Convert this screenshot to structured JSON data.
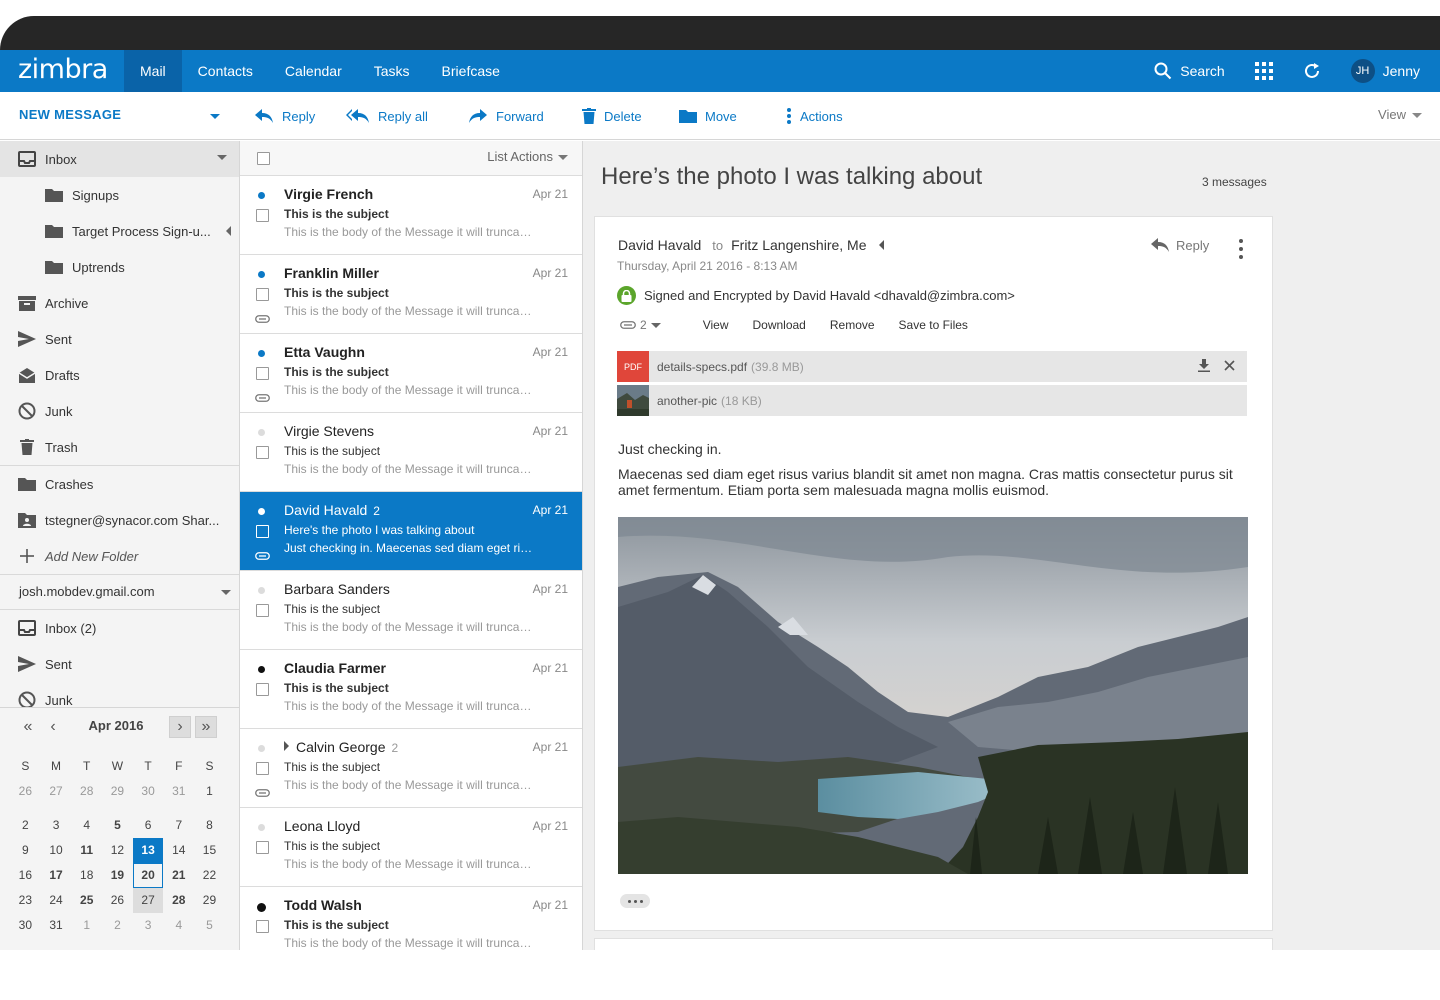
{
  "header": {
    "logo": "zimbra",
    "tabs": [
      {
        "label": "Mail"
      },
      {
        "label": "Contacts"
      },
      {
        "label": "Calendar"
      },
      {
        "label": "Tasks"
      },
      {
        "label": "Briefcase"
      }
    ],
    "search_label": "Search",
    "user": {
      "initials": "JH",
      "name": "Jenny"
    },
    "brand_color": "#0b79c6"
  },
  "toolbar": {
    "new_message": "NEW MESSAGE",
    "reply": "Reply",
    "reply_all": "Reply all",
    "forward": "Forward",
    "delete": "Delete",
    "move": "Move",
    "actions": "Actions",
    "view": "View"
  },
  "sidebar": {
    "folders": [
      {
        "label": "Inbox",
        "icon": "inbox-icon"
      },
      {
        "label": "Signups",
        "icon": "folder-icon"
      },
      {
        "label": "Target Process Sign-u...",
        "icon": "folder-icon"
      },
      {
        "label": "Uptrends",
        "icon": "folder-icon"
      },
      {
        "label": "Archive",
        "icon": "archive-icon"
      },
      {
        "label": "Sent",
        "icon": "send-icon"
      },
      {
        "label": "Drafts",
        "icon": "drafts-icon"
      },
      {
        "label": "Junk",
        "icon": "block-icon"
      },
      {
        "label": "Trash",
        "icon": "trash-icon"
      },
      {
        "label": "Crashes",
        "icon": "folder-icon"
      },
      {
        "label": "tstegner@synacor.com Shar...",
        "icon": "shared-folder-icon"
      },
      {
        "label": "Add New Folder",
        "icon": "plus-icon"
      }
    ],
    "account": {
      "label": "josh.mobdev.gmail.com",
      "folders": [
        {
          "label": "Inbox (2)",
          "icon": "inbox-icon"
        },
        {
          "label": "Sent",
          "icon": "send-icon"
        },
        {
          "label": "Junk",
          "icon": "block-icon"
        }
      ]
    }
  },
  "calendar": {
    "title": "Apr 2016",
    "weekdays": [
      "S",
      "M",
      "T",
      "W",
      "T",
      "F",
      "S"
    ],
    "weeks": [
      [
        "26",
        "27",
        "28",
        "29",
        "30",
        "31",
        "1"
      ],
      [
        "2",
        "3",
        "4",
        "5",
        "6",
        "7",
        "8"
      ],
      [
        "9",
        "10",
        "11",
        "12",
        "13",
        "14",
        "15"
      ],
      [
        "16",
        "17",
        "18",
        "19",
        "20",
        "21",
        "22"
      ],
      [
        "23",
        "24",
        "25",
        "26",
        "27",
        "28",
        "29"
      ],
      [
        "30",
        "31",
        "1",
        "2",
        "3",
        "4",
        "5"
      ]
    ]
  },
  "message_list": {
    "list_actions": "List Actions",
    "items": [
      {
        "sender": "Virgie French",
        "count": "",
        "date": "Apr 21",
        "subject": "This is the subject",
        "body": "This is the body of the Message it will truncate after one line",
        "unread": true,
        "dot": "blue",
        "attachment": false,
        "selected": false
      },
      {
        "sender": "Franklin Miller",
        "count": "",
        "date": "Apr 21",
        "subject": "This is the subject",
        "body": "This is the body of the Message it will truncate after one line",
        "unread": true,
        "dot": "blue",
        "attachment": true,
        "selected": false
      },
      {
        "sender": "Etta Vaughn",
        "count": "",
        "date": "Apr 21",
        "subject": "This is the subject",
        "body": "This is the body of the Message it will truncate after one line",
        "unread": true,
        "dot": "blue",
        "attachment": true,
        "selected": false
      },
      {
        "sender": "Virgie Stevens",
        "count": "",
        "date": "Apr 21",
        "subject": "This is the subject",
        "body": "This is the body of the Message it will truncate after one line",
        "unread": false,
        "dot": "grey",
        "attachment": false,
        "selected": false
      },
      {
        "sender": "David Havald",
        "count": "2",
        "date": "Apr 21",
        "subject": "Here's the photo I was talking about",
        "body": "Just checking in. Maecenas sed diam eget risus varius blandit",
        "unread": false,
        "dot": "white",
        "attachment": true,
        "selected": true
      },
      {
        "sender": "Barbara Sanders",
        "count": "",
        "date": "Apr 21",
        "subject": "This is the subject",
        "body": "This is the body of the Message it will truncate after one line",
        "unread": false,
        "dot": "grey",
        "attachment": false,
        "selected": false
      },
      {
        "sender": "Claudia Farmer",
        "count": "",
        "date": "Apr 21",
        "subject": "This is the subject",
        "body": "This is the body of the Message it will truncate after one line",
        "unread": true,
        "dot": "black",
        "attachment": false,
        "selected": false
      },
      {
        "sender": "Calvin George",
        "count": "2",
        "date": "Apr 21",
        "subject": "This is the subject",
        "body": "This is the body of the Message it will truncate after one line",
        "unread": false,
        "dot": "grey",
        "attachment": true,
        "selected": false,
        "thread": true
      },
      {
        "sender": "Leona Lloyd",
        "count": "",
        "date": "Apr 21",
        "subject": "This is the subject",
        "body": "This is the body of the Message it will truncate after one line",
        "unread": false,
        "dot": "grey",
        "attachment": false,
        "selected": false
      },
      {
        "sender": "Todd Walsh",
        "count": "",
        "date": "Apr 21",
        "subject": "This is the subject",
        "body": "This is the body of the Message it will truncate after one line",
        "unread": true,
        "dot": "black",
        "attachment": false,
        "selected": false
      }
    ]
  },
  "reading": {
    "title": "Here’s the photo I was talking about",
    "count": "3 messages",
    "from": "David Havald",
    "to_label": "to",
    "to": "Fritz Langenshire, Me",
    "date": "Thursday, April 21 2016 - 8:13 AM",
    "reply": "Reply",
    "signed": "Signed and Encrypted by David Havald <dhavald@zimbra.com>",
    "attachment_count": "2",
    "attachment_actions": [
      "View",
      "Download",
      "Remove",
      "Save to Files"
    ],
    "attachments": [
      {
        "name": "details-specs.pdf",
        "size": "(39.8 MB)",
        "badge": "PDF"
      },
      {
        "name": "another-pic",
        "size": "(18 KB)"
      }
    ],
    "body1": "Just checking in.",
    "body2": "Maecenas sed diam eget risus varius blandit sit amet non magna. Cras mattis consectetur purus sit amet fermentum. Etiam porta sem malesuada magna mollis euismod."
  }
}
